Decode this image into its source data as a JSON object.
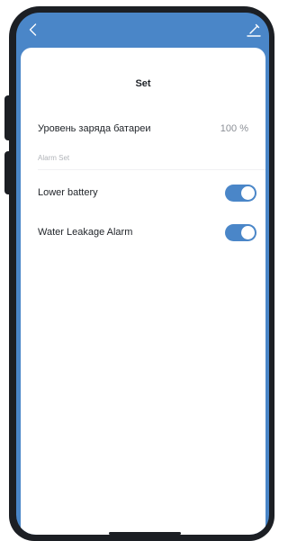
{
  "header": {
    "back_icon": "chevron-left-icon",
    "edit_icon": "edit-pencil-icon"
  },
  "sheet": {
    "title": "Set"
  },
  "battery": {
    "label": "Уровень заряда батареи",
    "value": "100 %"
  },
  "alarm_section": {
    "label": "Alarm Set",
    "items": [
      {
        "label": "Lower battery",
        "enabled": true
      },
      {
        "label": "Water Leakage Alarm",
        "enabled": true
      }
    ]
  },
  "colors": {
    "accent": "#4a86c8",
    "frame": "#1c1f24",
    "text": "#22262b",
    "muted": "#8b8f96"
  }
}
